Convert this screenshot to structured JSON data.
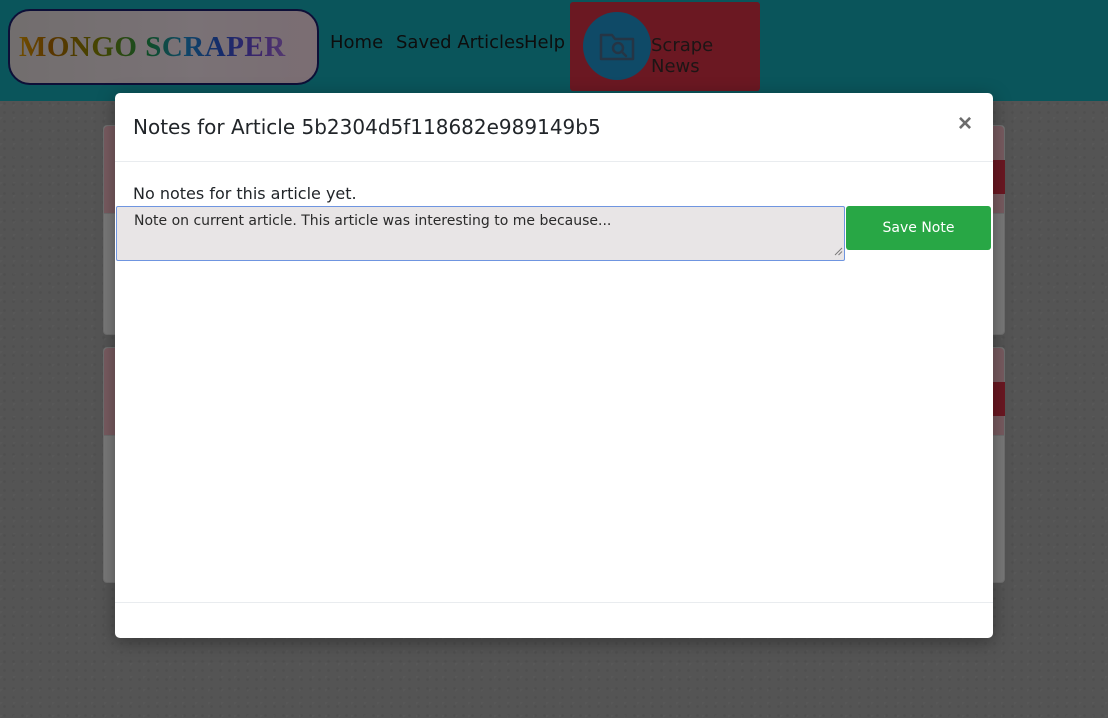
{
  "navbar": {
    "logo_text": "MONGO SCRAPER",
    "links": [
      "Home",
      "Saved Articles",
      "Help"
    ],
    "scrape_label": "Scrape News",
    "scrape_icon": "folder-search-icon"
  },
  "modal": {
    "title": "Notes for Article 5b2304d5f118682e989149b5",
    "close_symbol": "×",
    "empty_text": "No notes for this article yet.",
    "note_input": {
      "value": "Note on current article. This article was interesting to me because..."
    },
    "save_label": "Save Note"
  },
  "colors": {
    "navbar": "#14aab7",
    "scrape_button": "#d63045",
    "save_button": "#28a745"
  }
}
